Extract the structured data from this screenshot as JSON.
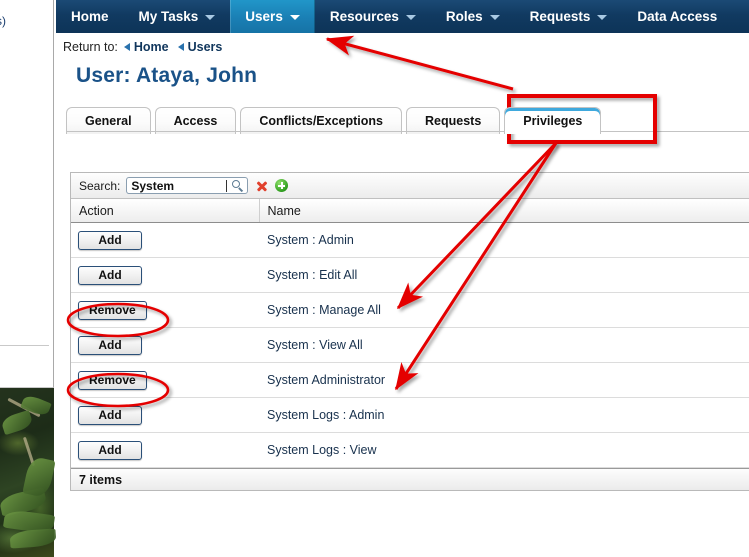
{
  "background": {
    "clipped_text": "s)"
  },
  "navbar": {
    "items": [
      {
        "label": "Home",
        "has_caret": false,
        "active": false
      },
      {
        "label": "My Tasks",
        "has_caret": true,
        "active": false
      },
      {
        "label": "Users",
        "has_caret": true,
        "active": true
      },
      {
        "label": "Resources",
        "has_caret": true,
        "active": false
      },
      {
        "label": "Roles",
        "has_caret": true,
        "active": false
      },
      {
        "label": "Requests",
        "has_caret": true,
        "active": false
      },
      {
        "label": "Data Access",
        "has_caret": false,
        "active": false
      }
    ]
  },
  "breadcrumb": {
    "label": "Return to:",
    "crumbs": [
      "Home",
      "Users"
    ]
  },
  "page": {
    "title": "User: Ataya, John"
  },
  "tabs": [
    {
      "label": "General",
      "active": false
    },
    {
      "label": "Access",
      "active": false
    },
    {
      "label": "Conflicts/Exceptions",
      "active": false
    },
    {
      "label": "Requests",
      "active": false
    },
    {
      "label": "Privileges",
      "active": true
    }
  ],
  "search": {
    "label": "Search:",
    "value": "System",
    "placeholder": "",
    "search_icon": "magnifier-icon",
    "clear_icon": "red-x-icon",
    "add_icon": "green-plus-icon"
  },
  "table": {
    "columns": [
      "Action",
      "Name"
    ],
    "rows": [
      {
        "action": "Add",
        "name": "System : Admin",
        "highlighted": false
      },
      {
        "action": "Add",
        "name": "System : Edit All",
        "highlighted": false
      },
      {
        "action": "Remove",
        "name": "System : Manage All",
        "highlighted": true
      },
      {
        "action": "Add",
        "name": "System : View All",
        "highlighted": false
      },
      {
        "action": "Remove",
        "name": "System Administrator",
        "highlighted": true
      },
      {
        "action": "Add",
        "name": "System Logs : Admin",
        "highlighted": false
      },
      {
        "action": "Add",
        "name": "System Logs : View",
        "highlighted": false
      }
    ],
    "footer": "7 items"
  },
  "annotations": {
    "color": "#e40000",
    "highlight_box": "privileges-tab",
    "ellipses": [
      "remove-button-manage-all",
      "remove-button-system-administrator"
    ],
    "arrows": [
      {
        "from": "privileges-tab-box",
        "to": "users-nav-item"
      },
      {
        "from": "privileges-tab-box",
        "to": "row-system-manage-all"
      },
      {
        "from": "privileges-tab-box",
        "to": "row-system-administrator"
      }
    ]
  }
}
